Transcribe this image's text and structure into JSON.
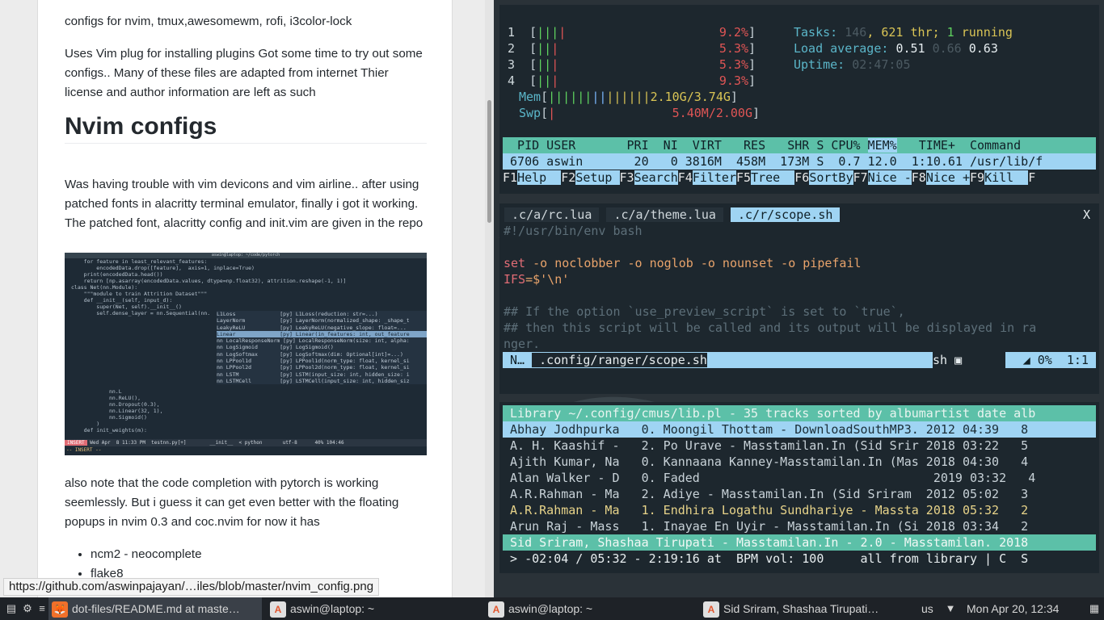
{
  "browser": {
    "intro": "configs for nvim, tmux,awesomewm, rofi, i3color-lock",
    "para2": "Uses Vim plug for installing plugins Got some time to try out some configs.. Many of these files are adapted from internet Thier license and author information are left as such",
    "heading": "Nvim configs",
    "para3": "Was having trouble with vim devicons and vim airline.. after using patched fonts in alacritty terminal emulator, finally i got it working. The patched font, alacritty config and init.vim are given in the repo",
    "screenshot": {
      "titlebar": "aswin@laptop: ~/code/pytorch",
      "code": [
        "    for feature in least_relevant_features:",
        "        encodedData.drop([feature],  axis=1, inplace=True)",
        "    print(encodedData.head())",
        "",
        "    return [np.asarray(encodedData.values, dtype=np.float32), attrition.reshape(-1, 1)]",
        "",
        "",
        "class Net(nn.Module):",
        "    \"\"\"module to train Attrition Dataset\"\"\"",
        "    def __init__(self, input_d):",
        "        super(Net, self).__init__()",
        "        self.dense_layer = nn.Sequential(nn."
      ],
      "popup": [
        "L1Loss              [py] L1Loss(reduction: str=...)",
        "LayerNorm           [py] LayerNorm(normalized_shape: _shape_t",
        "LeakyReLU           [py] LeakyReLU(negative_slope: float=...",
        "Linear              [py] Linear(in_features: int, out_feature",
        "nn LocalResponseNorm [py] LocalResponseNorm(size: int, alpha:",
        "nn LogSigmoid       [py] LogSigmoid()",
        "nn LogSoftmax       [py] LogSoftmax(dim: Optional[int]=...)",
        "nn LPPool1d         [py] LPPool1d(norm_type: float, kernel_si",
        "nn LPPool2d         [py] LPPool2d(norm_type: float, kernel_si",
        "nn LSTM             [py] LSTM(input_size: int, hidden_size: i",
        "nn LSTMCell         [py] LSTMCell(input_size: int, hidden_siz"
      ],
      "code2": [
        "            nn.L",
        "            nn.ReLU(),",
        "            nn.Dropout(0.3),",
        "            nn.Linear(32, 1),",
        "            nn.Sigmoid()",
        "        )",
        "",
        "",
        "    def init_weights(m):"
      ],
      "status_mode": "INSERT",
      "status_text": " Wed Apr  8 11:33 PM  testnn.py[+]        __init__  < python       utf-8      40% 104:46",
      "insert_line": "-- INSERT --"
    },
    "para4": "also note that the code completion with pytorch is working seemlessly. But i guess it can get even better with the floating popups in nvim 0.3 and coc.nvim for now it has",
    "list": [
      "ncm2 - neocomplete",
      "flake8"
    ],
    "hover_url": "https://github.com/aswinpajayan/…iles/blob/master/nvim_config.png"
  },
  "htop": {
    "cpus": [
      {
        "n": "1",
        "pct": "9.2%"
      },
      {
        "n": "2",
        "pct": "5.3%"
      },
      {
        "n": "3",
        "pct": "5.3%"
      },
      {
        "n": "4",
        "pct": "9.3%"
      }
    ],
    "mem": "2.10G/3.74G",
    "swp": "5.40M/2.00G",
    "tasks_label": "Tasks: ",
    "tasks": "146",
    "thr": ", 621 thr; ",
    "running": "1",
    "running_label": " running",
    "load_label": "Load average: ",
    "load1": "0.51",
    "load5": "0.66",
    "load15": "0.63",
    "uptime_label": "Uptime: ",
    "uptime": "02:47:05",
    "columns": "  PID USER       PRI  NI  VIRT   RES   SHR S CPU% ",
    "col_sort": "MEM%",
    "columns2": "   TIME+  Command",
    "process": " 6706 aswin       20   0 3816M  458M  173M S  0.7 12.0  1:10.61 /usr/lib/f",
    "fkeys": [
      {
        "k": "F1",
        "d": "Help  "
      },
      {
        "k": "F2",
        "d": "Setup "
      },
      {
        "k": "F3",
        "d": "Search"
      },
      {
        "k": "F4",
        "d": "Filter"
      },
      {
        "k": "F5",
        "d": "Tree  "
      },
      {
        "k": "F6",
        "d": "SortBy"
      },
      {
        "k": "F7",
        "d": "Nice -"
      },
      {
        "k": "F8",
        "d": "Nice +"
      },
      {
        "k": "F9",
        "d": "Kill  "
      },
      {
        "k": "F",
        "d": ""
      }
    ]
  },
  "nvim": {
    "tabs": [
      " .c/a/rc.lua ",
      " .c/a/theme.lua ",
      " .c/r/scope.sh "
    ],
    "close": "X",
    "shebang": "#!/usr/bin/env bash",
    "set_kw": "set",
    "set_rest": " -o noclobber -o noglob -o nounset -o pipefail",
    "ifs_kw": "IFS",
    "ifs_rest": "=$'\\n'",
    "comment1": "## If the option `use_preview_script` is set to `true`,",
    "comment2": "## then this script will be called and its output will be displayed in ra",
    "comment3": "nger.",
    "mode": " N… ",
    "file": " .config/ranger/scope.sh",
    "ft": "sh",
    "pos": " 0%  1:1 "
  },
  "cmus": {
    "header": " Library ~/.config/cmus/lib.pl - 35 tracks sorted by albumartist date alb",
    "rows": [
      {
        "t": " Abhay Jodhpurka   0. Moongil Thottam - DownloadSouthMP3. 2012 04:39   8",
        "cls": "cur"
      },
      {
        "t": " A. H. Kaashif -   2. Po Urave - Masstamilan.In (Sid Srir 2018 03:22   5",
        "cls": ""
      },
      {
        "t": " Ajith Kumar, Na   0. Kannaana Kanney-Masstamilan.In (Mas 2018 04:30   4",
        "cls": ""
      },
      {
        "t": " Alan Walker - D   0. Faded                                2019 03:32   4",
        "cls": ""
      },
      {
        "t": " A.R.Rahman - Ma   2. Adiye - Masstamilan.In (Sid Sriram  2012 05:02   3",
        "cls": ""
      },
      {
        "t": " A.R.Rahman - Ma   1. Endhira Logathu Sundhariye - Massta 2018 05:32   2",
        "cls": "playing"
      },
      {
        "t": " Arun Raj - Mass   1. Inayae En Uyir - Masstamilan.In (Si 2018 03:34   2",
        "cls": ""
      }
    ],
    "nowplaying": " Sid Sriram, Shashaa Tirupati - Masstamilan.In - 2.0 - Masstamilan. 2018",
    "status": " > -02:04 / 05:32 - 2:19:16 at  BPM vol: 100     all from library | C  S"
  },
  "taskbar": {
    "items": [
      {
        "label": "dot-files/README.md at maste…",
        "icon": "firefox-icon"
      },
      {
        "label": "aswin@laptop: ~",
        "icon": "alacritty-icon"
      },
      {
        "label": "aswin@laptop: ~",
        "icon": "alacritty-icon"
      },
      {
        "label": "Sid Sriram, Shashaa Tirupati…",
        "icon": "alacritty-icon"
      }
    ],
    "keyboard": "us",
    "clock": "Mon Apr 20, 12:34"
  }
}
